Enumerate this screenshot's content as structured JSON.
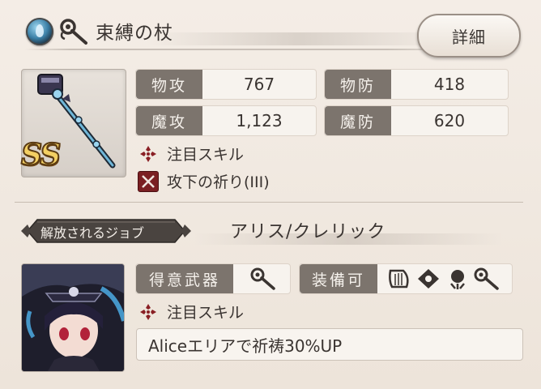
{
  "weapon": {
    "name": "束縛の杖",
    "rank": "SS",
    "detail_label": "詳細",
    "element_icon": "water-drop-icon",
    "type_icon": "staff-icon"
  },
  "stats": [
    {
      "label": "物攻",
      "value": "767"
    },
    {
      "label": "物防",
      "value": "418"
    },
    {
      "label": "魔攻",
      "value": "1,123"
    },
    {
      "label": "魔防",
      "value": "620"
    }
  ],
  "weapon_skills": {
    "focus_label": "注目スキル",
    "skill_name": "攻下の祈り(III)"
  },
  "job": {
    "banner_label": "解放されるジョブ",
    "name": "アリス/クレリック",
    "favorite_weapon_label": "得意武器",
    "equippable_label": "装備可",
    "focus_label": "注目スキル",
    "skill_text": "Aliceエリアで祈祷30%UP",
    "equippable_icons": [
      "harp-icon",
      "tome-icon",
      "orb-icon",
      "staff-icon"
    ]
  },
  "colors": {
    "label_bg": "#7c746d",
    "focus_cross": "#7a1f22",
    "rank_gold": "#f3cf63"
  }
}
